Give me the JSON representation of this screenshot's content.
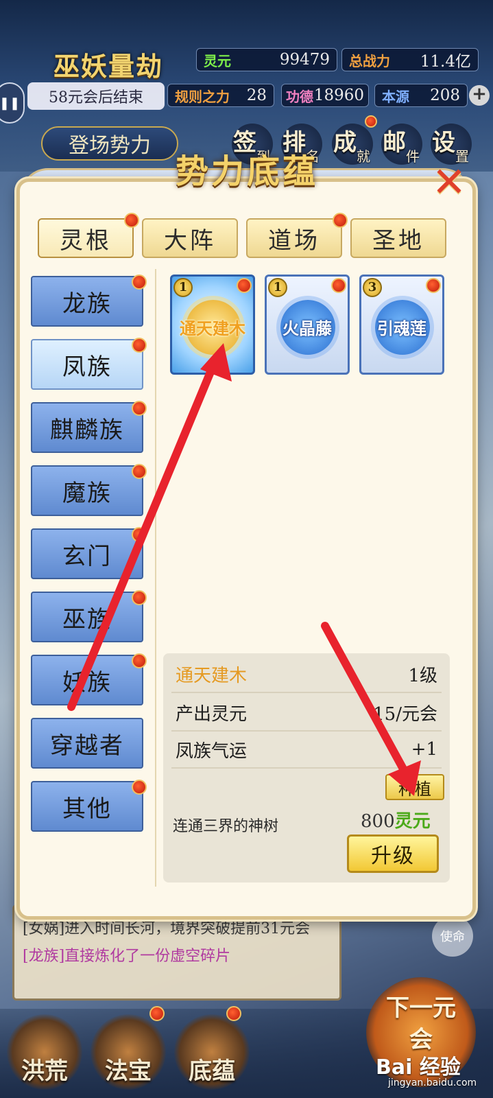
{
  "hud": {
    "game_title": "巫妖量劫",
    "countdown": "58元会后结束",
    "pause_icon": "pause-icon",
    "stats": [
      {
        "label": "灵元",
        "value": "99479"
      },
      {
        "label": "总战力",
        "value": "11.4亿"
      },
      {
        "label": "规则之力",
        "value": "28"
      },
      {
        "label": "功德",
        "value": "18960"
      },
      {
        "label": "本源",
        "value": "208"
      }
    ],
    "plus_icon": "plus-icon",
    "faction_button": "登场势力",
    "nav": [
      {
        "big": "签",
        "small": "到"
      },
      {
        "big": "排",
        "small": "名"
      },
      {
        "big": "成",
        "small": "就"
      },
      {
        "big": "邮",
        "small": "件"
      },
      {
        "big": "设",
        "small": "置"
      }
    ]
  },
  "modal": {
    "title": "势力底蕴",
    "close_icon": "close-x-icon",
    "tabs": [
      "灵根",
      "大阵",
      "道场",
      "圣地"
    ],
    "sidebar": [
      "龙族",
      "凤族",
      "麒麟族",
      "魔族",
      "玄门",
      "巫族",
      "妖族",
      "穿越者",
      "其他"
    ],
    "items": [
      {
        "count": "1",
        "name": "通天建木"
      },
      {
        "count": "1",
        "name": "火晶藤"
      },
      {
        "count": "3",
        "name": "引魂莲"
      }
    ],
    "detail": {
      "name": "通天建木",
      "level": "1级",
      "output_label": "产出灵元",
      "output_value": "15/元会",
      "luck_label": "凤族气运",
      "luck_value": "+1",
      "plant_button": "种植",
      "description": "连通三界的神树",
      "cost_amount": "800",
      "cost_unit": "灵元",
      "upgrade_button": "升级"
    }
  },
  "log": {
    "line1": "[女娲]进入时间长河，境界突破提前31元会",
    "line2": "[龙族]直接炼化了一份虚空碎片"
  },
  "mission_button": "使命",
  "bottom_tabs": [
    "洪荒",
    "法宝",
    "底蕴"
  ],
  "next_button": "下一元会",
  "watermark": {
    "main": "Bai 经验",
    "sub": "jingyan.baidu.com"
  },
  "colors": {
    "accent_gold": "#f4d26a",
    "annotation_red": "#e8232d",
    "card_blue": "#4a72b8"
  }
}
